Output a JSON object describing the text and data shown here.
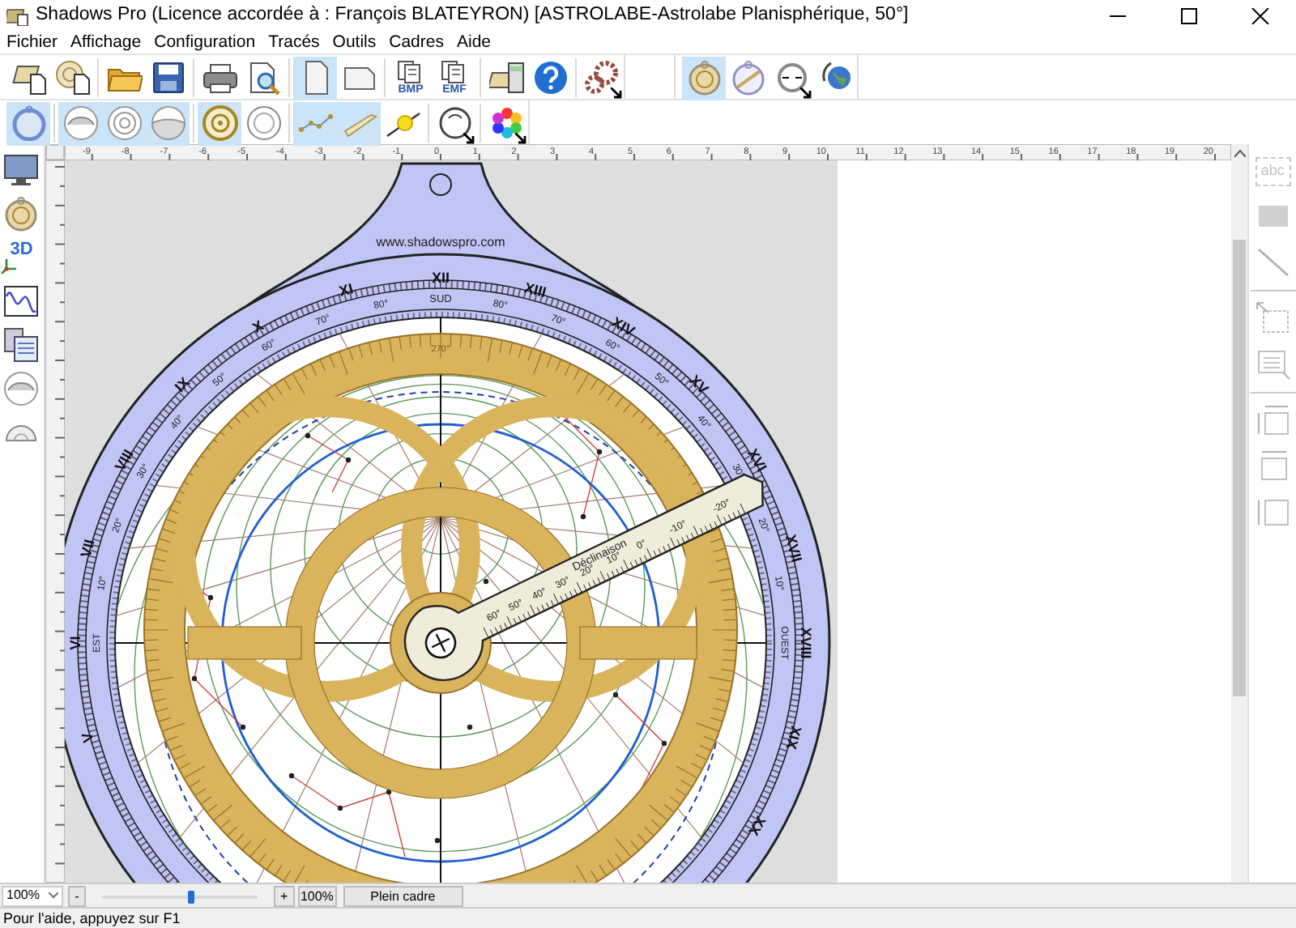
{
  "window": {
    "title": "Shadows Pro  (Licence accordée à :  François BLATEYRON) [ASTROLABE-Astrolabe Planisphérique, 50°]"
  },
  "menu": [
    "Fichier",
    "Affichage",
    "Configuration",
    "Tracés",
    "Outils",
    "Cadres",
    "Aide"
  ],
  "toolbar_rows": [
    {
      "bands": [
        {
          "groups": [
            [
              {
                "kind": "doc-book",
                "selected": false
              },
              {
                "kind": "doc-dial",
                "selected": false
              }
            ],
            [
              {
                "kind": "folder",
                "selected": false
              },
              {
                "kind": "save",
                "selected": false
              }
            ],
            [
              {
                "kind": "printer",
                "selected": false
              },
              {
                "kind": "preview",
                "selected": false
              }
            ],
            [
              {
                "kind": "page-portrait",
                "selected": true
              },
              {
                "kind": "page-landscape",
                "selected": false
              }
            ],
            [
              {
                "kind": "export",
                "selected": false,
                "label": "BMP"
              },
              {
                "kind": "export",
                "selected": false,
                "label": "EMF"
              }
            ],
            [
              {
                "kind": "calculator",
                "selected": false
              },
              {
                "kind": "help",
                "selected": false
              }
            ],
            [
              {
                "kind": "gears",
                "selected": false,
                "dropdown": true
              }
            ]
          ]
        },
        {
          "groups": [
            [
              {
                "kind": "astro-front",
                "selected": true
              },
              {
                "kind": "astro-back",
                "selected": false
              },
              {
                "kind": "rotate",
                "selected": false,
                "dropdown": true
              },
              {
                "kind": "globe",
                "selected": false
              }
            ]
          ]
        }
      ]
    },
    {
      "bands": [
        {
          "groups": [
            [
              {
                "kind": "ring",
                "selected": true
              }
            ],
            [
              {
                "kind": "dome",
                "selected": true
              },
              {
                "kind": "rings",
                "selected": true
              },
              {
                "kind": "half-dome",
                "selected": true
              }
            ],
            [
              {
                "kind": "dial-gold",
                "selected": true
              },
              {
                "kind": "dial-plain",
                "selected": false
              }
            ],
            [
              {
                "kind": "constellation",
                "selected": true
              },
              {
                "kind": "rule",
                "selected": true
              },
              {
                "kind": "sun-line",
                "selected": false
              }
            ],
            [
              {
                "kind": "dial-arrow",
                "selected": false,
                "dropdown": true
              }
            ],
            [
              {
                "kind": "color-wheel",
                "selected": false,
                "dropdown": true
              }
            ]
          ]
        }
      ]
    }
  ],
  "left_tools": [
    {
      "kind": "monitor"
    },
    {
      "kind": "astro-front"
    },
    {
      "kind": "three-d",
      "label": "3D"
    },
    {
      "kind": "wave"
    },
    {
      "kind": "documents"
    },
    {
      "kind": "dome"
    },
    {
      "kind": "protractor"
    }
  ],
  "ruler": {
    "top_labels": [
      "-9",
      "-8",
      "-7",
      "-6",
      "-5",
      "-4",
      "-3",
      "-2",
      "-1",
      "0",
      "1",
      "2",
      "3",
      "4",
      "5",
      "6",
      "7",
      "8",
      "9",
      "10",
      "11",
      "12",
      "13",
      "14",
      "15",
      "16",
      "17",
      "18",
      "19",
      "20"
    ]
  },
  "astrolabe": {
    "website": "www.shadowspro.com",
    "hours": [
      "V",
      "VI",
      "VII",
      "VIII",
      "IX",
      "X",
      "XI",
      "XII",
      "XIII",
      "XIV",
      "XV",
      "XVI",
      "XVII",
      "XVIII",
      "XIX",
      "XX"
    ],
    "limb_top": "SUD",
    "limb_left": "EST",
    "limb_right": "OUEST",
    "limb_left_degrees": [
      "80°",
      "70°",
      "60°",
      "50°",
      "40°",
      "30°",
      "20°",
      "10°"
    ],
    "limb_right_degrees": [
      "80°",
      "70°",
      "60°",
      "50°",
      "40°",
      "30°",
      "20°",
      "10°"
    ],
    "ecliptic_label": "270°",
    "rule_title": "Déclinaison",
    "rule_labels": [
      "60°",
      "50°",
      "40°",
      "30°",
      "20°",
      "10°",
      "0°",
      "-10°",
      "-20°"
    ]
  },
  "right_tools": [
    [
      {
        "kind": "text-box",
        "label": "abc",
        "disabled": true
      },
      {
        "kind": "filled-rect",
        "disabled": true
      },
      {
        "kind": "line",
        "disabled": true
      }
    ],
    [
      {
        "kind": "frame-arrow",
        "disabled": true
      },
      {
        "kind": "text-frame",
        "disabled": true
      }
    ],
    [
      {
        "kind": "resize-both",
        "disabled": true
      },
      {
        "kind": "resize-width",
        "disabled": true
      },
      {
        "kind": "resize-height",
        "disabled": true
      }
    ]
  ],
  "zoom_bar": {
    "zoom_select": "100%",
    "minus": "-",
    "level": 0.58,
    "plus": "+",
    "zoom_value": "100%",
    "fit_button": "Plein cadre"
  },
  "status_bar": "Pour l'aide, appuyez sur F1"
}
